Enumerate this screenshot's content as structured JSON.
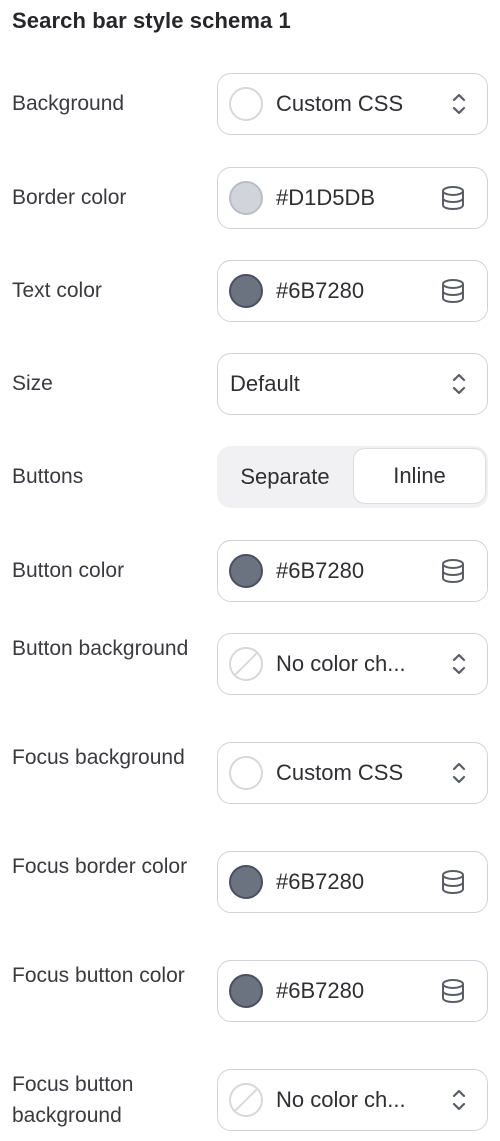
{
  "title": "Search bar style schema 1",
  "rows": [
    {
      "label": "Background",
      "value": "Custom CSS"
    },
    {
      "label": "Border color",
      "value": "#D1D5DB"
    },
    {
      "label": "Text color",
      "value": "#6B7280"
    },
    {
      "label": "Size",
      "value": "Default"
    },
    {
      "label": "Buttons",
      "options": [
        "Separate",
        "Inline"
      ],
      "selected": "Inline"
    },
    {
      "label": "Button color",
      "value": "#6B7280"
    },
    {
      "label": "Button background",
      "value": "No color ch..."
    },
    {
      "label": "Focus background",
      "value": "Custom CSS"
    },
    {
      "label": "Focus border color",
      "value": "#6B7280"
    },
    {
      "label": "Focus button color",
      "value": "#6B7280"
    },
    {
      "label": "Focus button background",
      "value": "No color ch..."
    }
  ],
  "colors": {
    "gray_500": "#6B7280",
    "gray_300": "#D1D5DB",
    "control_border": "#cfd2d8"
  },
  "icons": {
    "select": "chevron-up-down-icon",
    "variable": "database-icon",
    "empty_swatch": "no-color-swatch-icon"
  }
}
